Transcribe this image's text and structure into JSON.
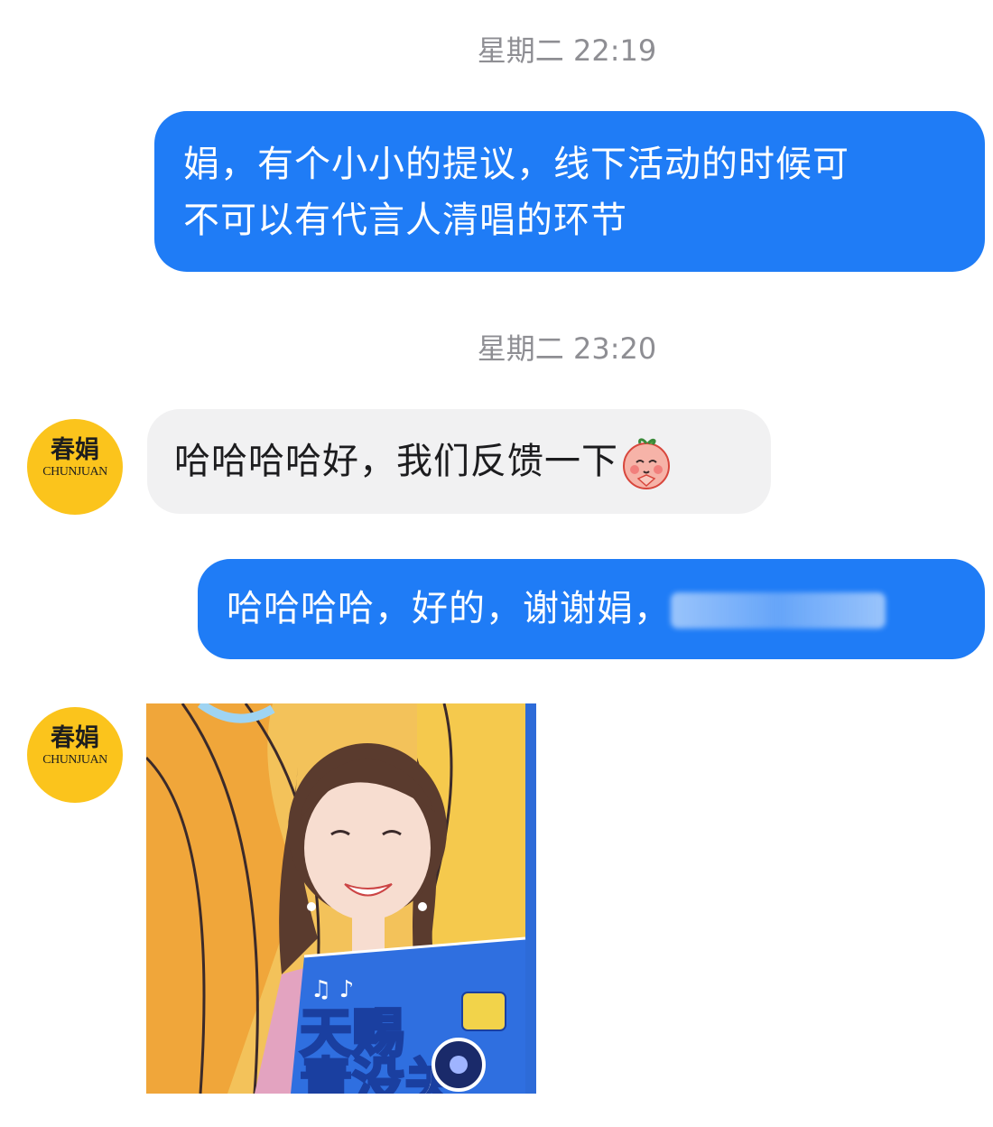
{
  "messages": {
    "ts1": "星期二 22:19",
    "msg1_line1": "娟，有个小小的提议，线下活动的时候可",
    "msg1_line2": "不可以有代言人清唱的环节",
    "ts2": "星期二 23:20",
    "msg2": "哈哈哈哈好，我们反馈一下",
    "msg3": "哈哈哈哈，好的，谢谢娟，"
  },
  "avatar": {
    "brand_cn": "春娟",
    "brand_en": "CHUNJUAN"
  },
  "image_message": {
    "sign_line1": "天赐",
    "sign_line2": "青没关"
  },
  "colors": {
    "outgoing_bubble": "#1f7cf6",
    "incoming_bubble": "#f1f1f2",
    "avatar_bg": "#fbc41c"
  }
}
